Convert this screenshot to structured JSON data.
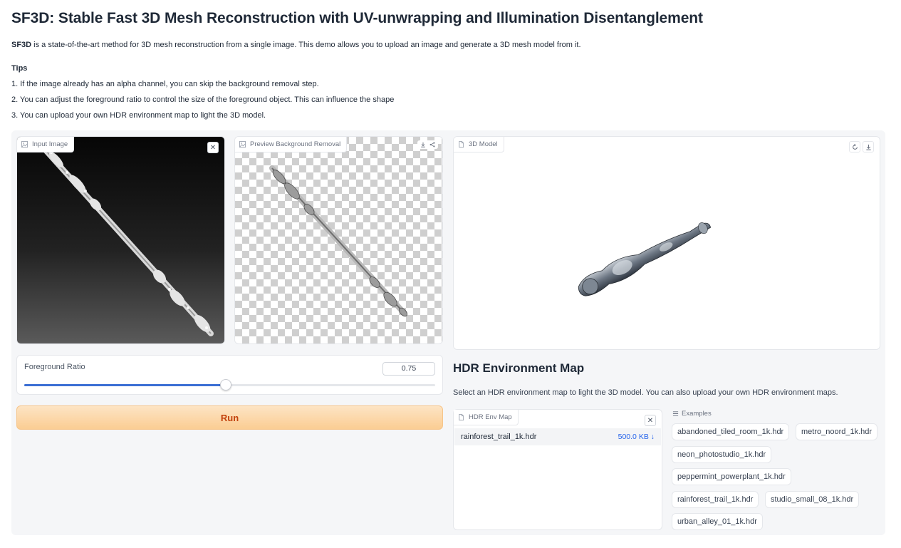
{
  "header": {
    "title": "SF3D: Stable Fast 3D Mesh Reconstruction with UV-unwrapping and Illumination Disentanglement",
    "intro_bold": "SF3D",
    "intro_rest": " is a state-of-the-art method for 3D mesh reconstruction from a single image. This demo allows you to upload an image and generate a 3D mesh model from it."
  },
  "tips": {
    "heading": "Tips",
    "items": [
      "1. If the image already has an alpha channel, you can skip the background removal step.",
      "2. You can adjust the foreground ratio to control the size of the foreground object. This can influence the shape",
      "3. You can upload your own HDR environment map to light the 3D model."
    ]
  },
  "panels": {
    "input_image_label": "Input Image",
    "preview_label": "Preview Background Removal",
    "model_label": "3D Model"
  },
  "slider": {
    "label": "Foreground Ratio",
    "value": "0.75",
    "fraction": 0.75
  },
  "run_button": "Run",
  "hdr": {
    "heading": "HDR Environment Map",
    "description": "Select an HDR environment map to light the 3D model. You can also upload your own HDR environment maps.",
    "panel_label": "HDR Env Map",
    "file_name": "rainforest_trail_1k.hdr",
    "file_size": "500.0 KB ↓"
  },
  "examples": {
    "heading": "Examples",
    "items": [
      "abandoned_tiled_room_1k.hdr",
      "metro_noord_1k.hdr",
      "neon_photostudio_1k.hdr",
      "peppermint_powerplant_1k.hdr",
      "rainforest_trail_1k.hdr",
      "studio_small_08_1k.hdr",
      "urban_alley_01_1k.hdr"
    ]
  },
  "colors": {
    "accent": "#3b6fd4",
    "run_text": "#c2410c",
    "run_bg": "#fbcd93"
  }
}
